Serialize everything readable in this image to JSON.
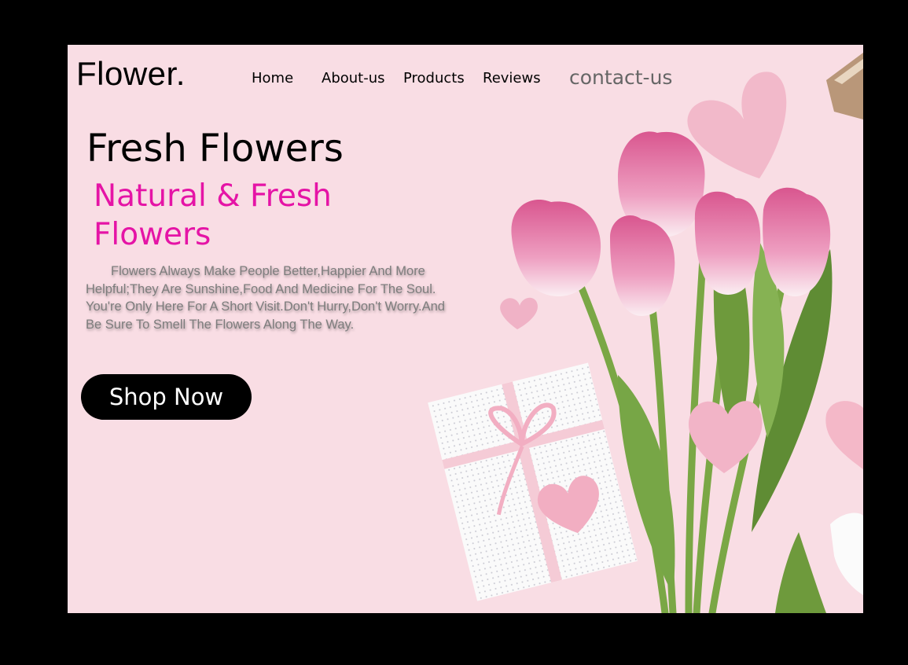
{
  "brand": {
    "logo": "Flower."
  },
  "nav": {
    "home": "Home",
    "about": "About-us",
    "products": "Products",
    "reviews": "Reviews",
    "contact": "contact-us"
  },
  "hero": {
    "title": "Fresh Flowers",
    "subtitle_line1": "Natural & Fresh",
    "subtitle_line2": "Flowers",
    "description": "Flowers Always Make People Better,Happier And More Helpful;They Are Sunshine,Food And Medicine For The Soul. You're Only Here For A Short Visit.Don't Hurry,Don't Worry.And Be Sure To Smell The Flowers Along The Way.",
    "cta": "Shop Now"
  },
  "colors": {
    "background": "#f9dde4",
    "accent": "#e514a6",
    "button": "#000000",
    "tulip": "#e07aa8",
    "stem": "#6e9a3c"
  }
}
